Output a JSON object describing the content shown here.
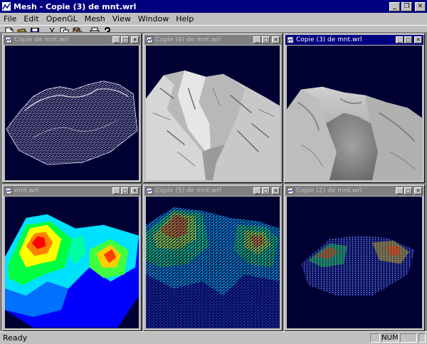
{
  "app": {
    "title": "Mesh - Copie (3) de mnt.wrl",
    "icon": "mesh-app-icon"
  },
  "menus": [
    "File",
    "Edit",
    "OpenGL",
    "Mesh",
    "View",
    "Window",
    "Help"
  ],
  "toolbar": [
    "new-file-icon",
    "open-folder-icon",
    "save-icon",
    "cut-icon",
    "copy-icon",
    "paste-icon",
    "print-icon",
    "help-icon"
  ],
  "windows": [
    {
      "title": "Copie de mnt.wrl",
      "render": "wireframe-white"
    },
    {
      "title": "Copie (4) de mnt.wrl",
      "render": "flat-shaded-gray"
    },
    {
      "title": "Copie (3) de mnt.wrl",
      "render": "smooth-shaded-gray",
      "active": true
    },
    {
      "title": "mnt.wrl",
      "render": "smooth-shaded-height-colormap"
    },
    {
      "title": "Copie (5) de mnt.wrl",
      "render": "wireframe-height-colormap"
    },
    {
      "title": "Copie (2) de mnt.wrl",
      "render": "points-height-colormap"
    }
  ],
  "status": {
    "text": "Ready",
    "indicator": "NUM"
  },
  "colors": {
    "titlebar_active": "#000080",
    "titlebar_inactive": "#808080",
    "viewport_bg": "#000033",
    "chrome": "#c0c0c0"
  }
}
